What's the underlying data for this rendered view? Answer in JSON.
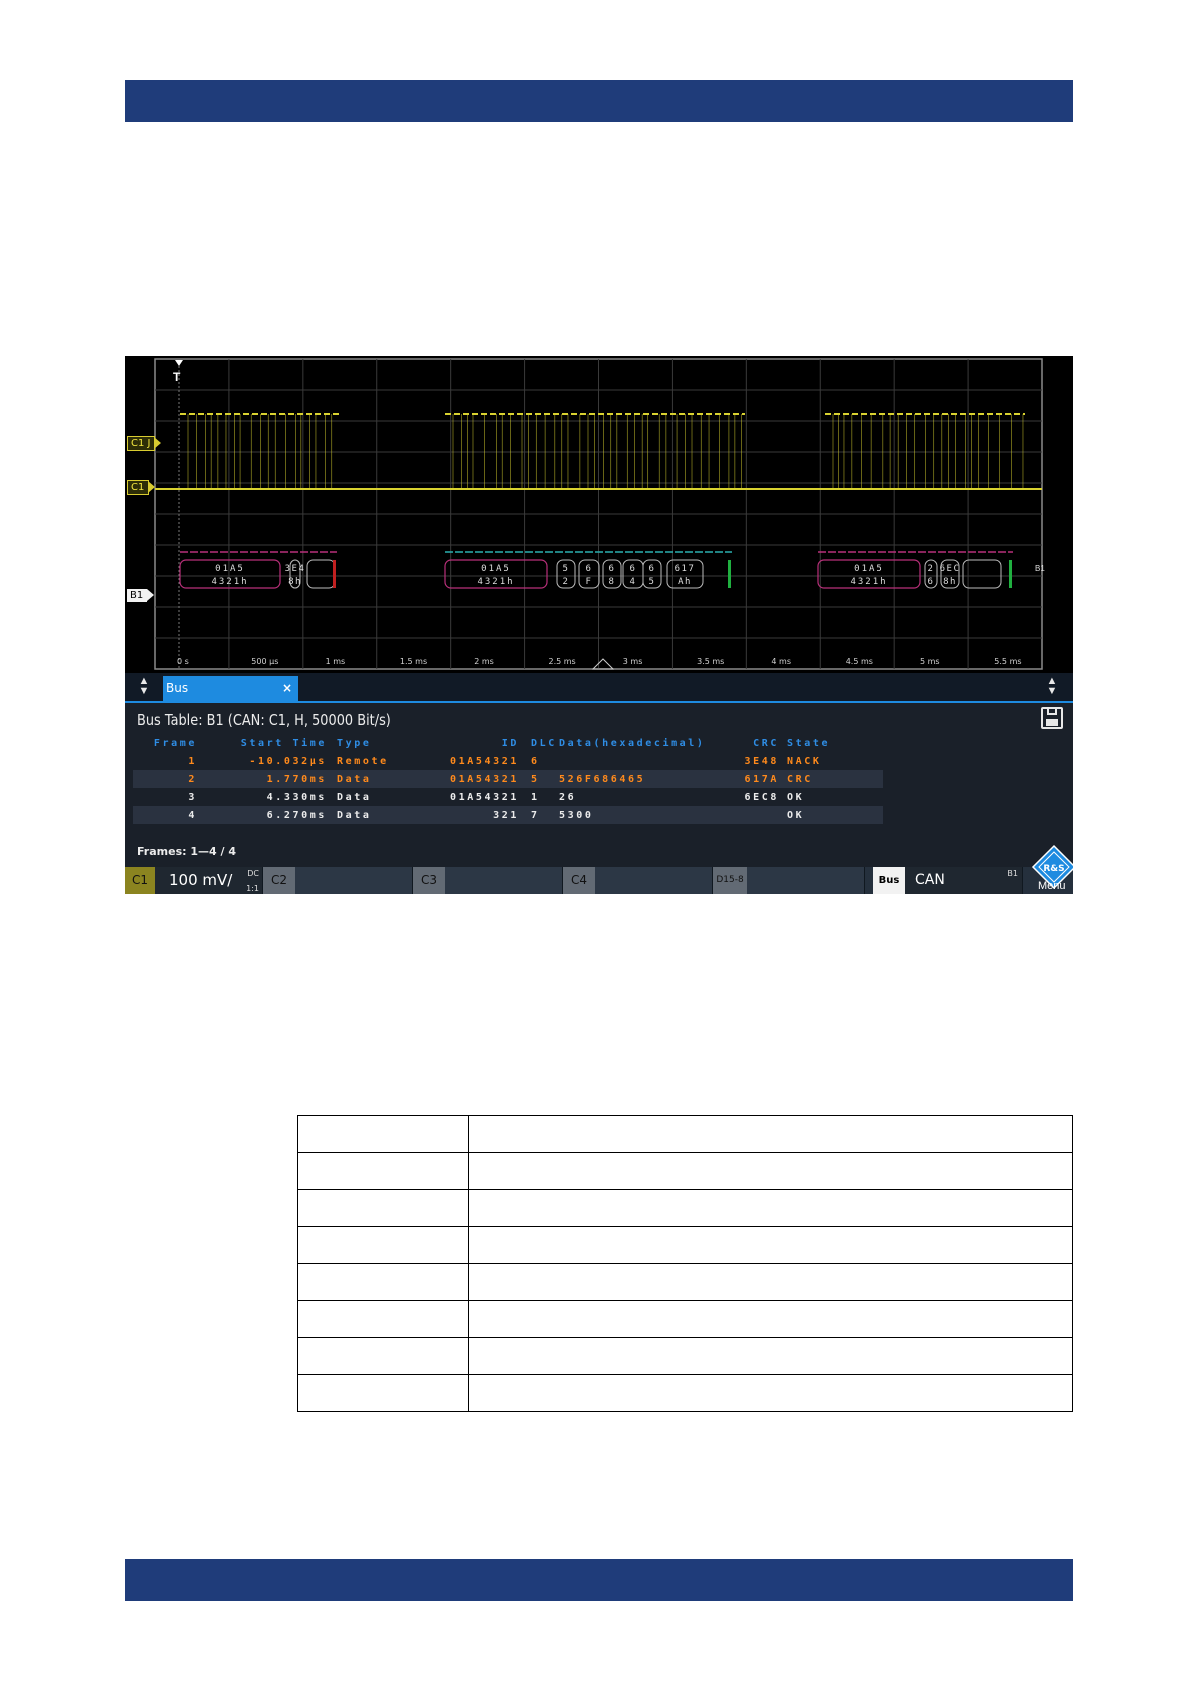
{
  "screenshot": {
    "channel_labels": {
      "c1_threshold": "C1 J",
      "c1": "C1",
      "b1": "B1",
      "b1_right": "B1",
      "trigger": "T"
    },
    "time_axis": [
      "0 s",
      "500 µs",
      "1 ms",
      "1.5 ms",
      "2 ms",
      "2.5 ms",
      "3 ms",
      "3.5 ms",
      "4 ms",
      "4.5 ms",
      "5 ms",
      "5.5 ms"
    ],
    "frames_decode": [
      {
        "id": [
          "01A5",
          "4321h"
        ],
        "data": [
          [
            "3E4",
            "8h"
          ]
        ]
      },
      {
        "id": [
          "01A5",
          "4321h"
        ],
        "data": [
          [
            "5",
            "2"
          ],
          [
            "6",
            "F"
          ],
          [
            "6",
            "8"
          ],
          [
            "6",
            "4"
          ],
          [
            "6",
            "5"
          ],
          [
            "617",
            "Ah"
          ]
        ]
      },
      {
        "id": [
          "01A5",
          "4321h"
        ],
        "data": [
          [
            "2",
            "6"
          ],
          [
            "6EC",
            "8h"
          ]
        ]
      }
    ],
    "tab": {
      "label": "Bus",
      "close": "×"
    },
    "table_title": "Bus Table: B1 (CAN: C1, H, 50000 Bit/s)",
    "table": {
      "columns": [
        "Frame",
        "Start Time",
        "Type",
        "ID",
        "DLC",
        "Data(hexadecimal)",
        "CRC",
        "State"
      ],
      "rows": [
        [
          "1",
          "-10.032µs",
          "Remote",
          "01A54321",
          "6",
          "",
          "3E48",
          "NACK"
        ],
        [
          "2",
          "1.770ms",
          "Data",
          "01A54321",
          "5",
          "526F686465",
          "617A",
          "CRC"
        ],
        [
          "3",
          "4.330ms",
          "Data",
          "01A54321",
          "1",
          "26",
          "6EC8",
          "OK"
        ],
        [
          "4",
          "6.270ms",
          "Data",
          "321",
          "7",
          "5300",
          "",
          "OK"
        ]
      ]
    },
    "frames_summary": "Frames: 1—4 / 4",
    "bottom_bar": {
      "c1": "C1",
      "c1_scale": "100 mV/",
      "c1_coupling": "DC",
      "c1_ratio": "1:1",
      "c2": "C2",
      "c3": "C3",
      "c4": "C4",
      "digital": "D15-8",
      "bus": "Bus",
      "bus_protocol": "CAN",
      "bus_id": "B1",
      "menu": "Menu"
    },
    "logo_text": "R&S",
    "colors": {
      "trace": "#d9d230",
      "frame1_color": "#b8307a",
      "data_color": "#2ab0b0",
      "highlight": "#ff8a1c",
      "header_blue": "#2f8de4",
      "band": "#1f3c7a"
    }
  },
  "doc_table_rows": 8
}
